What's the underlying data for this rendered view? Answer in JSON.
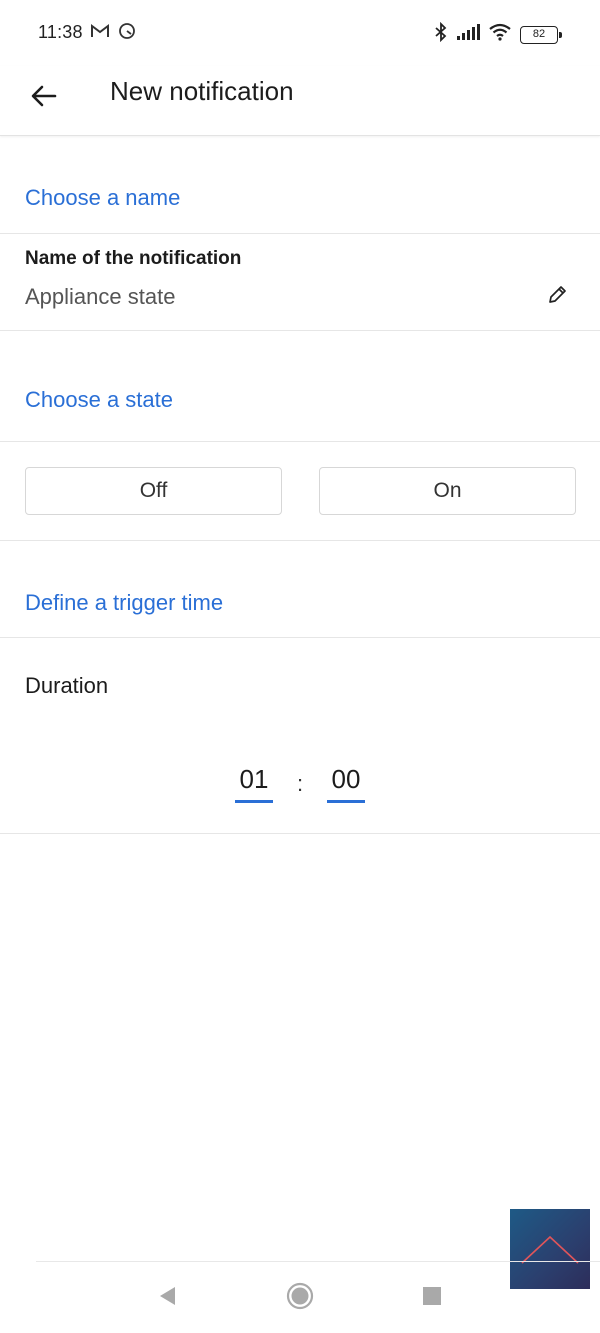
{
  "status_bar": {
    "time": "11:38",
    "battery": "82",
    "icons": [
      "gmail-icon",
      "sync-icon",
      "bluetooth-icon",
      "signal-icon",
      "wifi-icon",
      "battery-icon"
    ]
  },
  "app_bar": {
    "title": "New notification",
    "back_icon": "arrow-left-icon"
  },
  "name_section": {
    "heading": "Choose a name",
    "field_label": "Name of the notification",
    "field_value": "Appliance state",
    "edit_icon": "pencil-icon"
  },
  "state_section": {
    "heading": "Choose a state",
    "options": [
      "Off",
      "On"
    ]
  },
  "trigger_section": {
    "heading": "Define a trigger time",
    "duration_label": "Duration",
    "hours": "01",
    "separator": ":",
    "minutes": "00"
  },
  "navigation": {
    "icons": [
      "back-triangle-icon",
      "home-circle-icon",
      "recents-square-icon"
    ]
  },
  "colors": {
    "accent": "#2a6fd6",
    "divider": "#e6e6e6"
  }
}
